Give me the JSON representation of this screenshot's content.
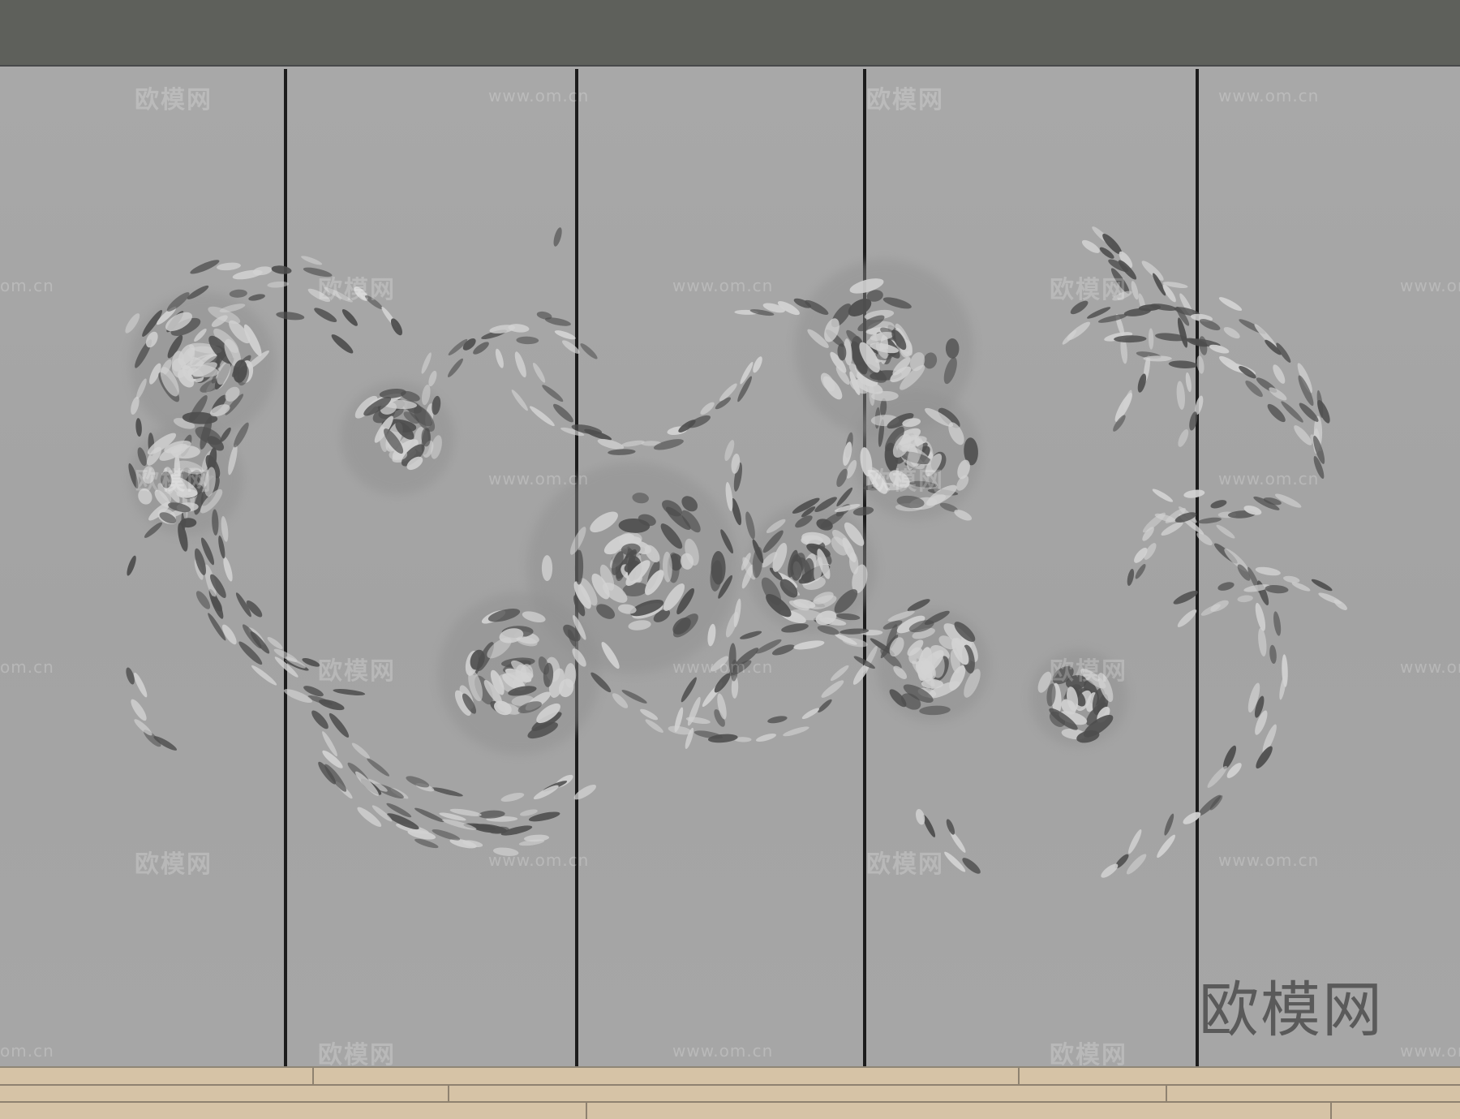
{
  "colors": {
    "ceiling": "#5e605b",
    "wall": "#a5a5a5",
    "seam": "#1c1c1c",
    "floor": "#d6c3a6",
    "petal_dark": "#4e4e4e",
    "petal_light": "#d2d2d2"
  },
  "watermarks": {
    "brand": "欧模网",
    "url": "www.om.cn",
    "url_short": "om.cn"
  },
  "logo": {
    "text": "欧模网"
  }
}
